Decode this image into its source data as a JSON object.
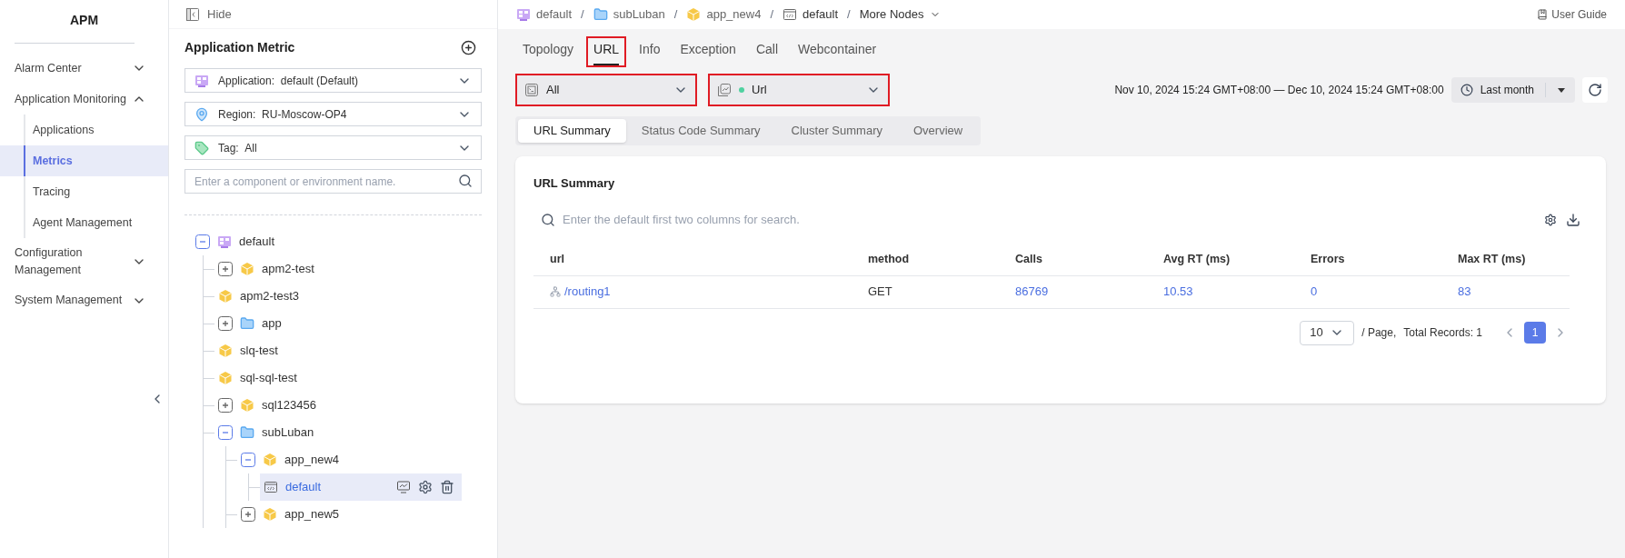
{
  "sidebar": {
    "title": "APM",
    "items": [
      {
        "label": "Alarm Center",
        "expanded": false
      },
      {
        "label": "Application Monitoring",
        "expanded": true,
        "children": [
          {
            "label": "Applications",
            "selected": false
          },
          {
            "label": "Metrics",
            "selected": true
          },
          {
            "label": "Tracing",
            "selected": false
          },
          {
            "label": "Agent Management",
            "selected": false
          }
        ]
      },
      {
        "label": "Configuration Management",
        "expanded": false
      },
      {
        "label": "System Management",
        "expanded": false
      }
    ]
  },
  "panel": {
    "hide_label": "Hide",
    "title": "Application Metric",
    "filters": [
      {
        "kind": "app",
        "label": "Application:",
        "value": "default (Default)"
      },
      {
        "kind": "region",
        "label": "Region:",
        "value": "RU-Moscow-OP4"
      },
      {
        "kind": "tag",
        "label": "Tag:",
        "value": "All"
      }
    ],
    "search": {
      "placeholder": "Enter a component or environment name."
    },
    "tree": [
      {
        "label": "default",
        "kind": "app",
        "expanded": true,
        "selected": false,
        "children": [
          {
            "label": "apm2-test",
            "kind": "component",
            "expanded": false,
            "selected": false
          },
          {
            "label": "apm2-test3",
            "kind": "component",
            "selected": false
          },
          {
            "label": "app",
            "kind": "folder",
            "expanded": false,
            "selected": false
          },
          {
            "label": "slq-test",
            "kind": "component",
            "selected": false
          },
          {
            "label": "sql-sql-test",
            "kind": "component",
            "selected": false
          },
          {
            "label": "sql123456",
            "kind": "component",
            "expanded": false,
            "selected": false
          },
          {
            "label": "subLuban",
            "kind": "folder",
            "expanded": true,
            "selected": false,
            "children": [
              {
                "label": "app_new4",
                "kind": "component",
                "expanded": true,
                "selected": false,
                "children": [
                  {
                    "label": "default",
                    "kind": "environment",
                    "selected": true
                  }
                ]
              },
              {
                "label": "app_new5",
                "kind": "component",
                "expanded": false,
                "selected": false
              }
            ]
          }
        ]
      }
    ]
  },
  "breadcrumb": [
    {
      "label": "default",
      "kind": "app"
    },
    {
      "separator": "/",
      "label": "subLuban",
      "kind": "folder"
    },
    {
      "separator": "/",
      "label": "app_new4",
      "kind": "component"
    },
    {
      "separator": "/",
      "label": "default",
      "kind": "environment"
    },
    {
      "separator": "/",
      "label": "More Nodes",
      "kind": "more"
    }
  ],
  "user_guide": "User Guide",
  "tabs": [
    {
      "label": "Topology",
      "selected": false,
      "highlighted": false
    },
    {
      "label": "URL",
      "selected": true,
      "highlighted": true
    },
    {
      "label": "Info",
      "selected": false,
      "highlighted": false
    },
    {
      "label": "Exception",
      "selected": false,
      "highlighted": false
    },
    {
      "label": "Call",
      "selected": false,
      "highlighted": false
    },
    {
      "label": "Webcontainer",
      "selected": false,
      "highlighted": false
    }
  ],
  "selects": [
    {
      "kind": "instance",
      "value": "All",
      "highlighted": true
    },
    {
      "kind": "collector",
      "value": "Url",
      "highlighted": true
    }
  ],
  "time_range": {
    "text": "Nov 10, 2024 15:24 GMT+08:00 — Dec 10, 2024 15:24 GMT+08:00",
    "preset": "Last month"
  },
  "subtabs": [
    {
      "label": "URL Summary",
      "selected": true
    },
    {
      "label": "Status Code Summary",
      "selected": false
    },
    {
      "label": "Cluster Summary",
      "selected": false
    },
    {
      "label": "Overview",
      "selected": false
    }
  ],
  "card": {
    "title": "URL Summary",
    "search": {
      "placeholder": "Enter the default first two columns for search."
    },
    "columns": [
      "url",
      "method",
      "Calls",
      "Avg RT (ms)",
      "Errors",
      "Max RT (ms)"
    ],
    "rows": [
      {
        "cells": [
          {
            "text": "/routing1",
            "link": true
          },
          {
            "text": "GET",
            "link": false
          },
          {
            "text": "86769",
            "link": true
          },
          {
            "text": "10.53",
            "link": true
          },
          {
            "text": "0",
            "link": true
          },
          {
            "text": "83",
            "link": true
          }
        ]
      }
    ],
    "pagination": {
      "page_size": "10",
      "per_page_label": "/ Page,",
      "total": "Total Records: 1",
      "pages": [
        {
          "label": "1",
          "selected": true
        }
      ]
    }
  }
}
